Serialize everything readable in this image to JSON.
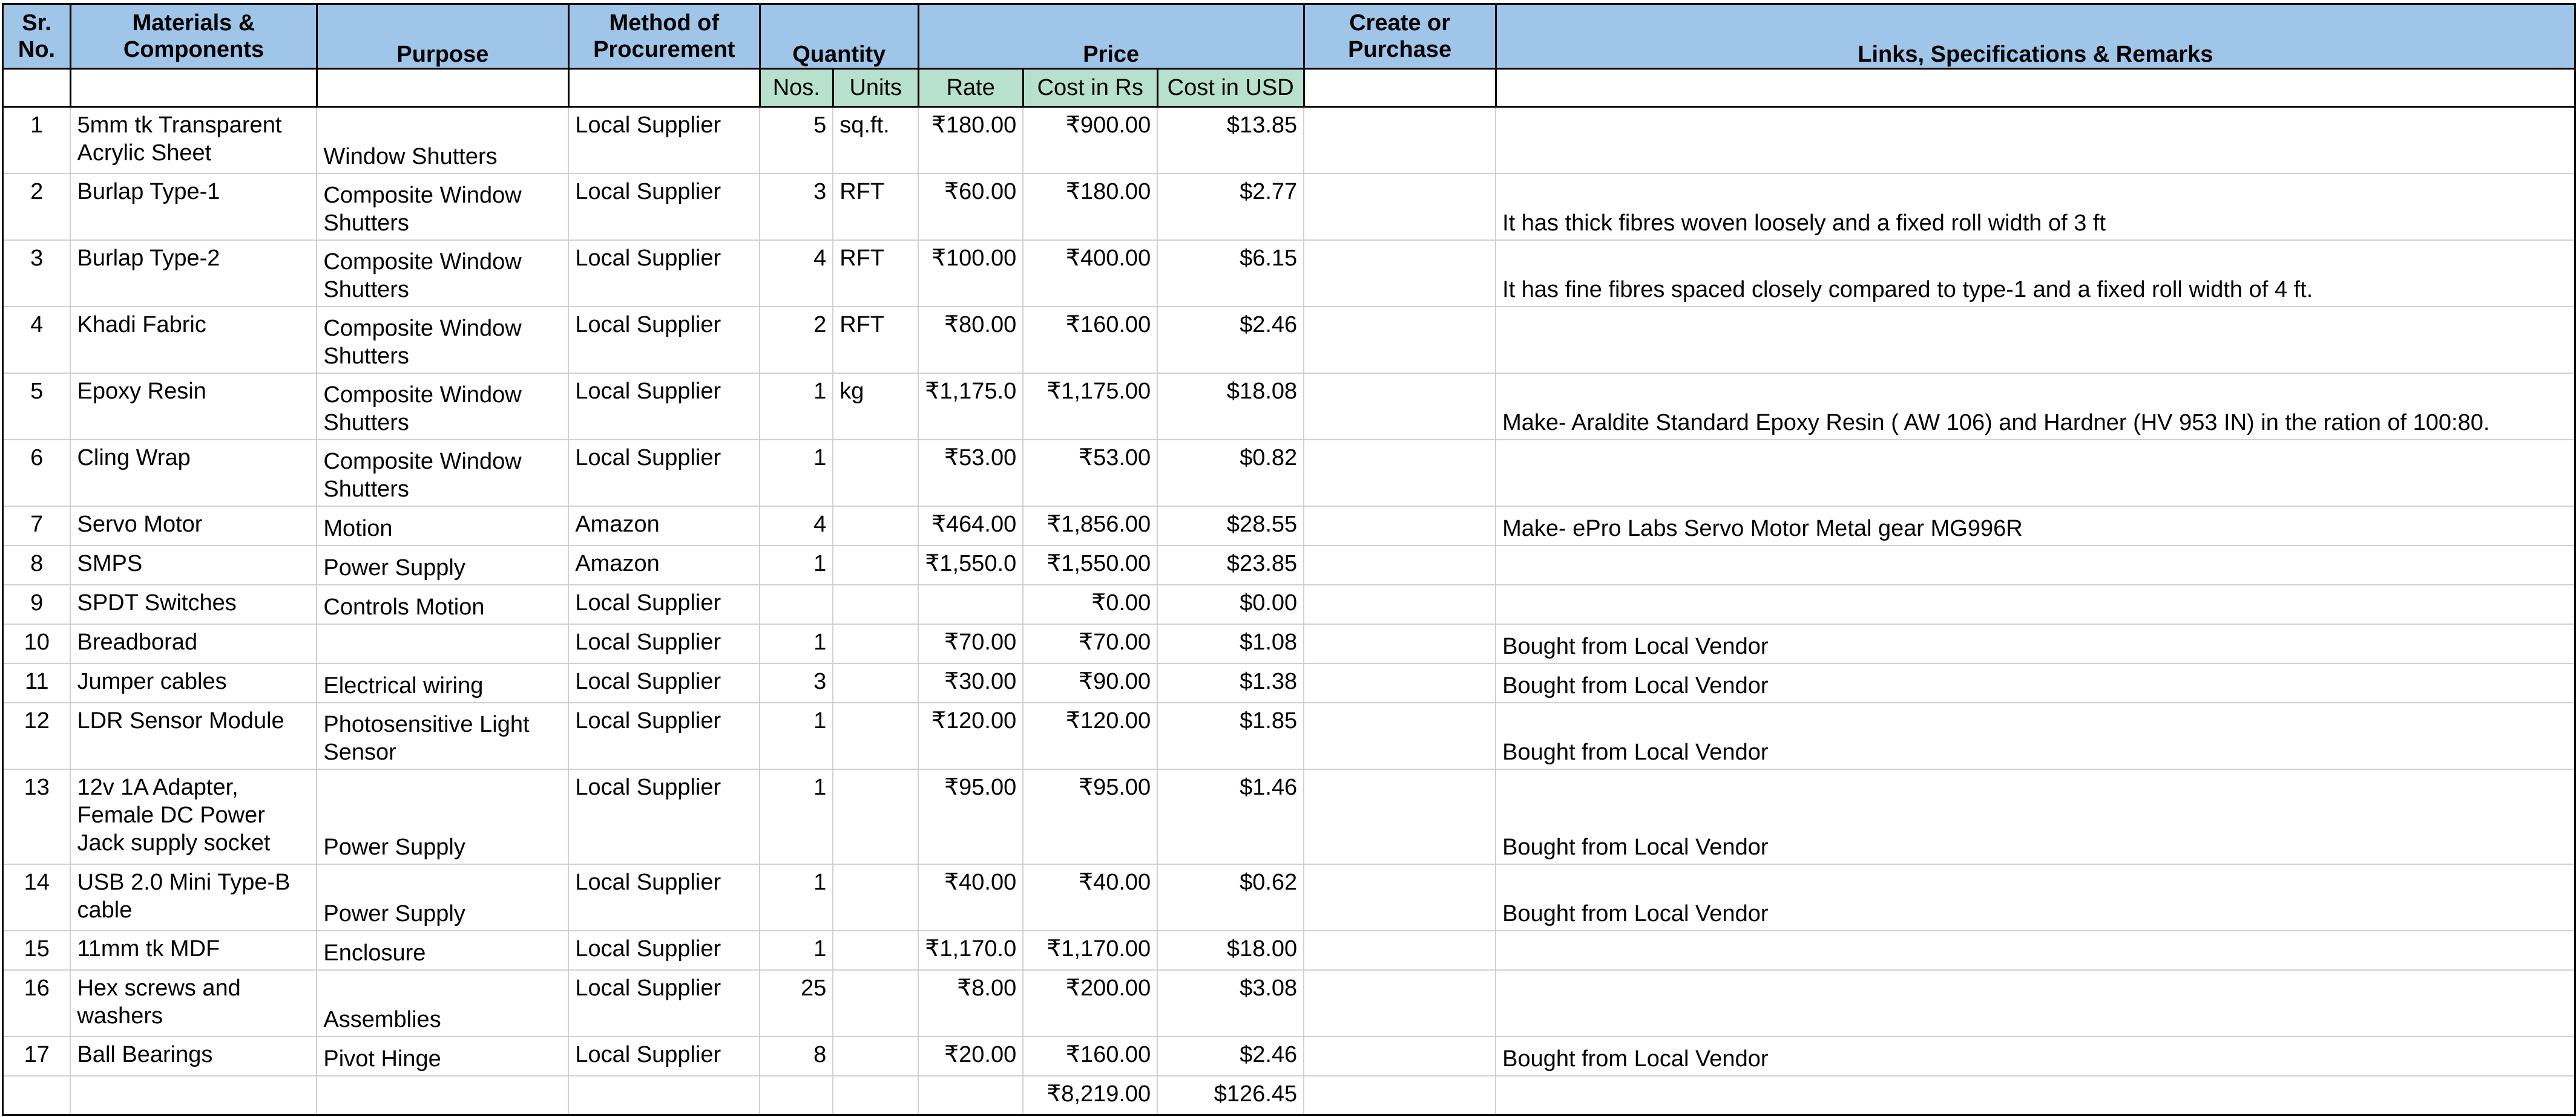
{
  "headers": {
    "sr_no": "Sr. No.",
    "materials": "Materials & Components",
    "purpose": "Purpose",
    "method": "Method of Procurement",
    "quantity": "Quantity",
    "price": "Price",
    "create_purchase": "Create or Purchase",
    "links": "Links, Specifications & Remarks",
    "nos": "Nos.",
    "units": "Units",
    "rate": "Rate",
    "cost_rs": "Cost in Rs",
    "cost_usd": "Cost in USD"
  },
  "rows": [
    {
      "sr": "1",
      "material": "5mm tk Transparent Acrylic Sheet",
      "purpose": "Window Shutters",
      "method": "Local Supplier",
      "nos": "5",
      "units": "sq.ft.",
      "rate": "₹180.00",
      "cost_rs": "₹900.00",
      "cost_usd": "$13.85",
      "create": "",
      "remarks": ""
    },
    {
      "sr": "2",
      "material": "Burlap Type-1",
      "purpose": "Composite Window Shutters",
      "method": "Local Supplier",
      "nos": "3",
      "units": "RFT",
      "rate": "₹60.00",
      "cost_rs": "₹180.00",
      "cost_usd": "$2.77",
      "create": "",
      "remarks": "It has thick fibres woven  loosely and a fixed roll width of 3 ft"
    },
    {
      "sr": "3",
      "material": "Burlap Type-2",
      "purpose": "Composite Window Shutters",
      "method": "Local Supplier",
      "nos": "4",
      "units": "RFT",
      "rate": "₹100.00",
      "cost_rs": "₹400.00",
      "cost_usd": "$6.15",
      "create": "",
      "remarks": "It has fine fibres spaced closely compared to type-1 and a fixed roll width of 4 ft."
    },
    {
      "sr": "4",
      "material": "Khadi Fabric",
      "purpose": "Composite Window Shutters",
      "method": "Local Supplier",
      "nos": "2",
      "units": "RFT",
      "rate": "₹80.00",
      "cost_rs": "₹160.00",
      "cost_usd": "$2.46",
      "create": "",
      "remarks": ""
    },
    {
      "sr": "5",
      "material": "Epoxy Resin",
      "purpose": "Composite Window Shutters",
      "method": "Local Supplier",
      "nos": "1",
      "units": "kg",
      "rate": "₹1,175.0",
      "cost_rs": "₹1,175.00",
      "cost_usd": "$18.08",
      "create": "",
      "remarks": "Make- Araldite Standard Epoxy Resin ( AW 106) and Hardner (HV 953 IN) in the ration of 100:80."
    },
    {
      "sr": "6",
      "material": "Cling Wrap",
      "purpose": "Composite Window Shutters",
      "method": "Local Supplier",
      "nos": "1",
      "units": "",
      "rate": "₹53.00",
      "cost_rs": "₹53.00",
      "cost_usd": "$0.82",
      "create": "",
      "remarks": ""
    },
    {
      "sr": "7",
      "material": "Servo Motor",
      "purpose": "Motion",
      "method": "Amazon",
      "nos": "4",
      "units": "",
      "rate": "₹464.00",
      "cost_rs": "₹1,856.00",
      "cost_usd": "$28.55",
      "create": "",
      "remarks": "Make- ePro Labs Servo Motor Metal gear MG996R"
    },
    {
      "sr": "8",
      "material": "SMPS",
      "purpose": "Power Supply",
      "method": "Amazon",
      "nos": "1",
      "units": "",
      "rate": "₹1,550.0",
      "cost_rs": "₹1,550.00",
      "cost_usd": "$23.85",
      "create": "",
      "remarks": ""
    },
    {
      "sr": "9",
      "material": "SPDT Switches",
      "purpose": "Controls Motion",
      "method": "Local Supplier",
      "nos": "",
      "units": "",
      "rate": "",
      "cost_rs": "₹0.00",
      "cost_usd": "$0.00",
      "create": "",
      "remarks": ""
    },
    {
      "sr": "10",
      "material": "Breadborad",
      "purpose": "",
      "method": "Local Supplier",
      "nos": "1",
      "units": "",
      "rate": "₹70.00",
      "cost_rs": "₹70.00",
      "cost_usd": "$1.08",
      "create": "",
      "remarks": "Bought from Local Vendor"
    },
    {
      "sr": "11",
      "material": "Jumper cables",
      "purpose": "Electrical wiring",
      "method": "Local Supplier",
      "nos": "3",
      "units": "",
      "rate": "₹30.00",
      "cost_rs": "₹90.00",
      "cost_usd": "$1.38",
      "create": "",
      "remarks": "Bought from Local Vendor"
    },
    {
      "sr": "12",
      "material": "LDR Sensor Module",
      "purpose": "Photosensitive Light Sensor",
      "method": "Local Supplier",
      "nos": "1",
      "units": "",
      "rate": "₹120.00",
      "cost_rs": "₹120.00",
      "cost_usd": "$1.85",
      "create": "",
      "remarks": "Bought from Local Vendor"
    },
    {
      "sr": "13",
      "material": "12v 1A Adapter, Female DC Power Jack supply socket",
      "purpose": "Power Supply",
      "method": "Local Supplier",
      "nos": "1",
      "units": "",
      "rate": "₹95.00",
      "cost_rs": "₹95.00",
      "cost_usd": "$1.46",
      "create": "",
      "remarks": "Bought from Local Vendor"
    },
    {
      "sr": "14",
      "material": "USB 2.0 Mini Type-B cable",
      "purpose": "Power Supply",
      "method": "Local Supplier",
      "nos": "1",
      "units": "",
      "rate": "₹40.00",
      "cost_rs": "₹40.00",
      "cost_usd": "$0.62",
      "create": "",
      "remarks": "Bought from Local Vendor"
    },
    {
      "sr": "15",
      "material": "11mm tk MDF",
      "purpose": "Enclosure",
      "method": "Local Supplier",
      "nos": "1",
      "units": "",
      "rate": "₹1,170.0",
      "cost_rs": "₹1,170.00",
      "cost_usd": "$18.00",
      "create": "",
      "remarks": ""
    },
    {
      "sr": "16",
      "material": "Hex screws and washers",
      "purpose": "Assemblies",
      "method": "Local Supplier",
      "nos": "25",
      "units": "",
      "rate": "₹8.00",
      "cost_rs": "₹200.00",
      "cost_usd": "$3.08",
      "create": "",
      "remarks": ""
    },
    {
      "sr": "17",
      "material": "Ball Bearings",
      "purpose": "Pivot Hinge",
      "method": "Local Supplier",
      "nos": "8",
      "units": "",
      "rate": "₹20.00",
      "cost_rs": "₹160.00",
      "cost_usd": "$2.46",
      "create": "",
      "remarks": "Bought from Local Vendor"
    },
    {
      "sr": "",
      "material": "",
      "purpose": "",
      "method": "",
      "nos": "",
      "units": "",
      "rate": "",
      "cost_rs": "₹8,219.00",
      "cost_usd": "$126.45",
      "create": "",
      "remarks": ""
    }
  ],
  "colors": {
    "header_blue": "#9fc5e8",
    "header_green": "#b7e1cd"
  }
}
